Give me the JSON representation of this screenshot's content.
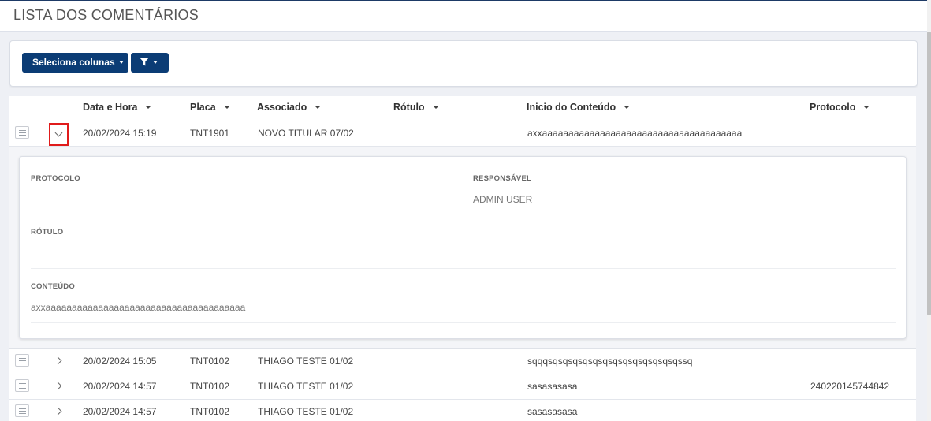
{
  "page": {
    "title": "LISTA DOS COMENTÁRIOS"
  },
  "toolbar": {
    "select_columns_label": "Seleciona colunas",
    "filter_icon": "filter-icon"
  },
  "table": {
    "columns": [
      "Data e Hora",
      "Placa",
      "Associado",
      "Rótulo",
      "Inicio do Conteúdo",
      "Protocolo"
    ],
    "rows": [
      {
        "datetime": "20/02/2024 15:19",
        "placa": "TNT1901",
        "associado": "NOVO TITULAR 07/02",
        "rotulo": "",
        "conteudo": "axxaaaaaaaaaaaaaaaaaaaaaaaaaaaaaaaaaaaaaa",
        "protocolo": "",
        "expanded": true
      },
      {
        "datetime": "20/02/2024 15:05",
        "placa": "TNT0102",
        "associado": "THIAGO TESTE 01/02",
        "rotulo": "",
        "conteudo": "sqqqsqsqsqsqsqsqsqsqsqsqsqsqsqssq",
        "protocolo": "",
        "expanded": false
      },
      {
        "datetime": "20/02/2024 14:57",
        "placa": "TNT0102",
        "associado": "THIAGO TESTE 01/02",
        "rotulo": "",
        "conteudo": "sasasasasa",
        "protocolo": "240220145744842",
        "expanded": false
      },
      {
        "datetime": "20/02/2024 14:57",
        "placa": "TNT0102",
        "associado": "THIAGO TESTE 01/02",
        "rotulo": "",
        "conteudo": "sasasasasa",
        "protocolo": "",
        "expanded": false
      }
    ]
  },
  "detail": {
    "protocolo_label": "PROTOCOLO",
    "protocolo_value": "",
    "responsavel_label": "RESPONSÁVEL",
    "responsavel_value": "ADMIN USER",
    "rotulo_label": "RÓTULO",
    "rotulo_value": "",
    "conteudo_label": "CONTEÚDO",
    "conteudo_value": "axxaaaaaaaaaaaaaaaaaaaaaaaaaaaaaaaaaaaaaa"
  },
  "colors": {
    "primary": "#0b3c75",
    "highlight_border": "#e01b1b"
  }
}
